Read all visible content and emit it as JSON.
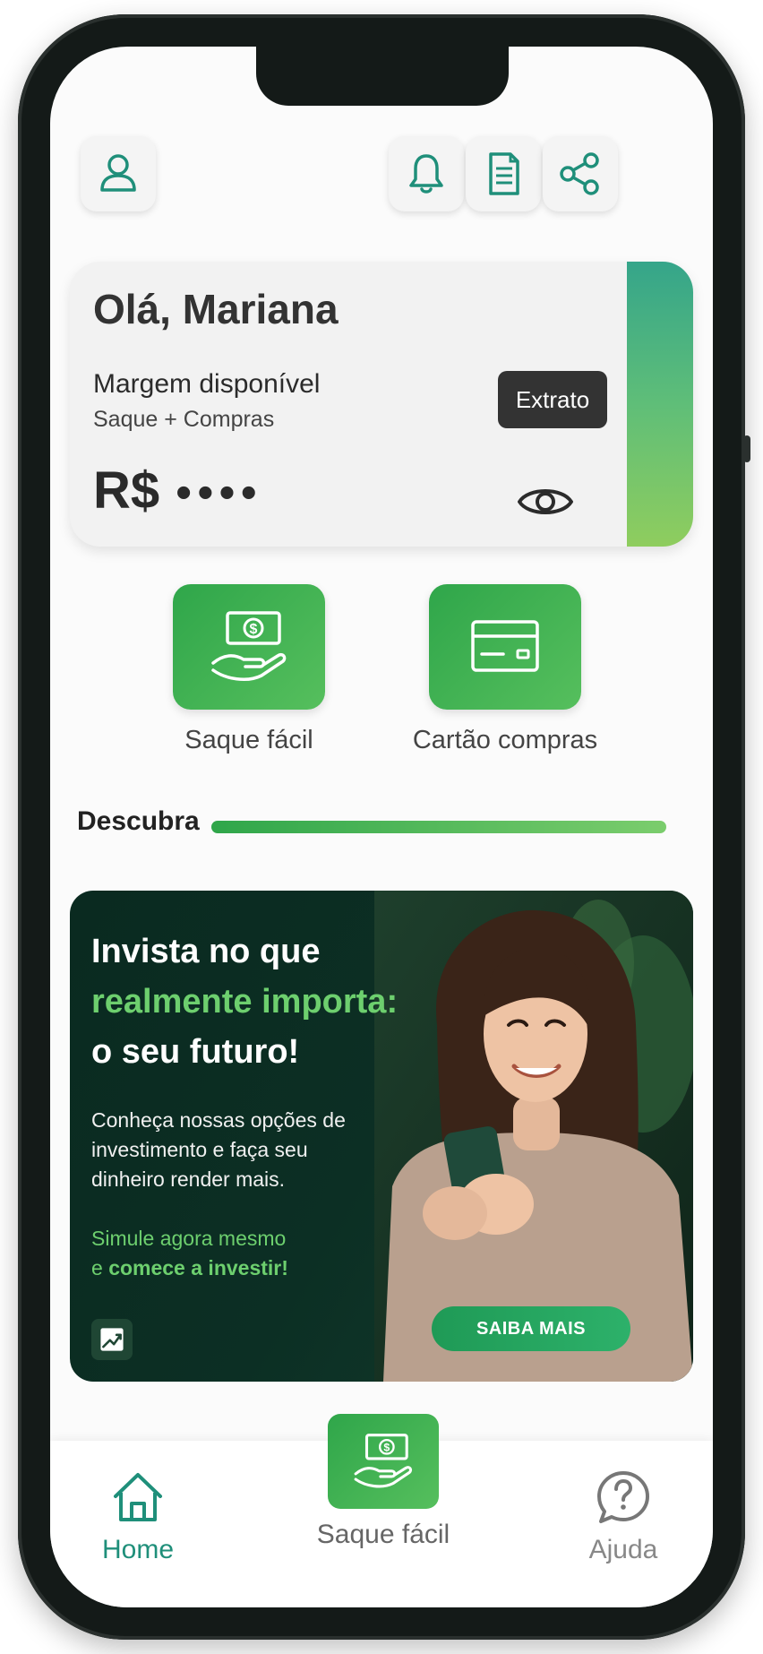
{
  "colors": {
    "brand_teal": "#1f8f7a",
    "brand_green": "#2fa64a",
    "dark_button": "#333333",
    "banner_bg": "#0a2a20",
    "banner_accent_text": "#6dcf6e"
  },
  "header": {
    "icons": [
      "user-icon",
      "bell-icon",
      "document-icon",
      "share-icon"
    ]
  },
  "card": {
    "greeting": "Olá, Mariana",
    "margin_label": "Margem disponível",
    "margin_sub": "Saque + Compras",
    "statement_button": "Extrato",
    "currency": "R$",
    "hidden_value": "••••",
    "visibility_icon": "eye-icon"
  },
  "actions": [
    {
      "label": "Saque fácil",
      "icon": "cash-hand-icon"
    },
    {
      "label": "Cartão compras",
      "icon": "credit-card-icon"
    }
  ],
  "discover": {
    "title": "Descubra"
  },
  "banner": {
    "headline_1": "Invista no que",
    "headline_2": "realmente importa:",
    "headline_3": "o seu futuro!",
    "body": "Conheça nossas opções de investimento e faça seu dinheiro render mais.",
    "cta_1": "Simule agora mesmo",
    "cta_2_prefix": "e ",
    "cta_2_bold": "comece a investir!",
    "button": "SAIBA MAIS",
    "icon": "chart-up-icon"
  },
  "bottom_nav": {
    "home": "Home",
    "center": "Saque fácil",
    "help": "Ajuda"
  }
}
